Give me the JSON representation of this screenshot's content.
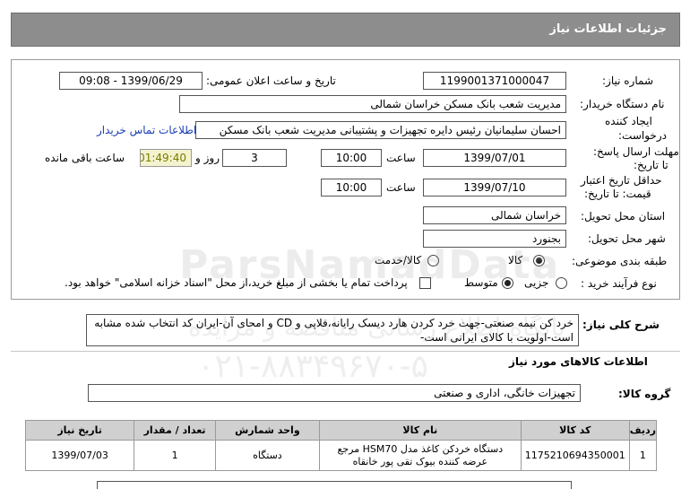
{
  "header": {
    "title": "جزئیات اطلاعات نیاز"
  },
  "fields": {
    "need_number_label": "شماره نیاز:",
    "need_number": "1199001371000047",
    "announce_label": "تاریخ و ساعت اعلان عمومی:",
    "announce_value": "1399/06/29 - 09:08",
    "buyer_label": "نام دستگاه خریدار:",
    "buyer_value": "مدیریت شعب بانک مسکن خراسان شمالی",
    "creator_label_1": "ایجاد کننده",
    "creator_label_2": "درخواست:",
    "creator_value": "احسان  سلیمانیان رئیس دایره تجهیزات و پشتیبانی مدیریت شعب بانک مسکن",
    "contact_link": "اطلاعات تماس خریدار",
    "deadline_label_1": "مهلت ارسال پاسخ:",
    "deadline_label_2": "تا تاریخ:",
    "deadline_date": "1399/07/01",
    "time_label": "ساعت",
    "deadline_time": "10:00",
    "days_value": "3",
    "days_label": "روز و",
    "remaining_time": "01:49:40",
    "remaining_label": "ساعت باقی مانده",
    "validity_label_1": "حداقل تاریخ اعتبار",
    "validity_label_2": "قیمت: تا تاریخ:",
    "validity_date": "1399/07/10",
    "validity_time_label": "ساعت",
    "validity_time": "10:00",
    "province_label": "استان محل تحویل:",
    "province_value": "خراسان شمالی",
    "city_label": "شهر محل تحویل:",
    "city_value": "بجنورد",
    "category_label": "طبقه بندی موضوعی:",
    "category_goods": "کالا",
    "category_goods_services": "کالا/خدمت",
    "process_label": "نوع فرآیند خرید :",
    "process_partial": "جزیی",
    "process_medium": "متوسط",
    "payment_note": "پرداخت تمام یا بخشی از مبلغ خرید،از محل \"اسناد خزانه اسلامی\" خواهد بود."
  },
  "description": {
    "label": "شرح کلی نیاز:",
    "text": "خرد کن نیمه صنعتی-جهت خرد کردن هارد دیسک رایانه،فلاپی و CD و امحای آن-ایران کد انتخاب شده مشابه است-اولویت با کالای ایرانی است-"
  },
  "goods_section": {
    "title": "اطلاعات کالاهای مورد نیاز",
    "group_label": "گروه کالا:",
    "group_value": "تجهیزات خانگی، اداری و صنعتی"
  },
  "table": {
    "headers": [
      "ردیف",
      "کد کالا",
      "نام کالا",
      "واحد شمارش",
      "تعداد / مقدار",
      "تاریخ نیاز"
    ],
    "rows": [
      {
        "row": "1",
        "code": "1175210694350001",
        "name": "دستگاه خردکن کاغذ مدل HSM70 مرجع عرضه کننده بیوک تقی پور خانقاه",
        "unit": "دستگاه",
        "qty": "1",
        "date": "1399/07/03"
      }
    ]
  },
  "watermark": {
    "brand": "ParsNamadData",
    "line2": "پایگاه اطلاع رسانی مناقصه و مزایده",
    "phone": "۰۲۱-۸۸۳۴۹۶۷۰-۵"
  }
}
